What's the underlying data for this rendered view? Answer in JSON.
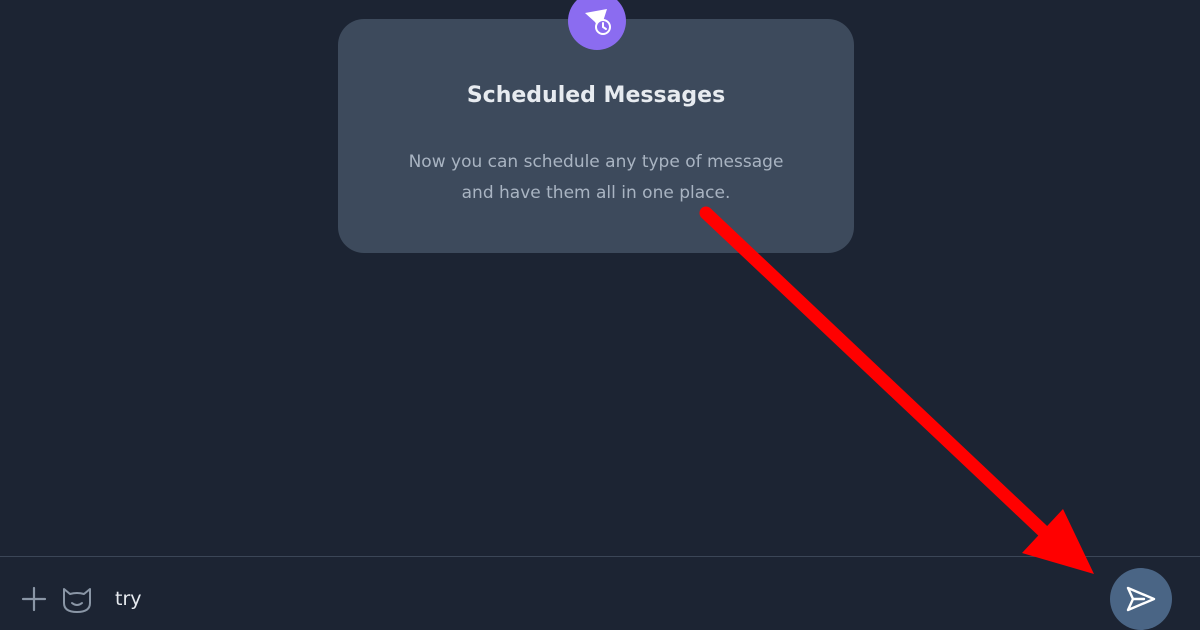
{
  "card": {
    "icon": "scheduled-message-icon",
    "title": "Scheduled Messages",
    "description_line1": "Now you can schedule any type of message",
    "description_line2": "and have them all in one place."
  },
  "composer": {
    "attach_icon": "plus-icon",
    "emoji_icon": "sticker-cat-icon",
    "message_value": "try",
    "send_icon": "send-icon"
  },
  "annotation": {
    "arrow_icon": "red-arrow-annotation",
    "color": "#ff0000"
  },
  "colors": {
    "background": "#1c2433",
    "card": "#3d4a5c",
    "accent": "#8b6cf0",
    "send_button": "#4a6585"
  }
}
